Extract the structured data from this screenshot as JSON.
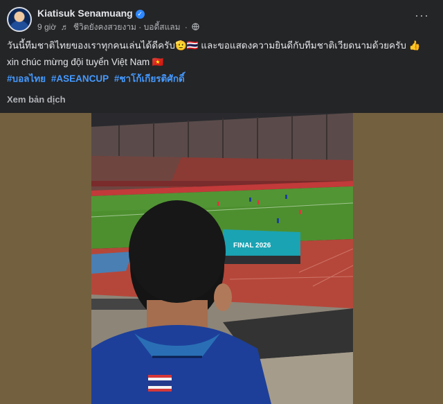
{
  "post": {
    "author": "Kiatisuk Senamuang",
    "time": "9 giờ",
    "music_note_icon": "music-note-icon",
    "song": "ชีวิตยังคงสวยงาม · บอดี้สแลม",
    "audience_separator": "·",
    "audience_icon": "globe-icon",
    "more_label": "···",
    "line1": "วันนี้ทีมชาติไทยของเราทุกคนเล่นได้ดีครับ🫡🇹🇭 และขอแสดงความยินดีกับทีมชาติเวียดนามด้วยครับ 👍",
    "line2": "xin chúc mừng đội tuyển Việt Nam 🇻🇳",
    "hashtags": [
      "#บอลไทย",
      "#ASEANCUP",
      "#ชาโก้เกียรติศักดิ์"
    ],
    "translate_label": "Xem bản dịch",
    "photo_banner_text": "FINAL 2026"
  },
  "colors": {
    "background": "#242526",
    "media_backdrop": "#73603f",
    "hashtag": "#4599ff",
    "pitch": "#4d8f2f",
    "track": "#b5473a",
    "jersey": "#1d3f9a"
  }
}
